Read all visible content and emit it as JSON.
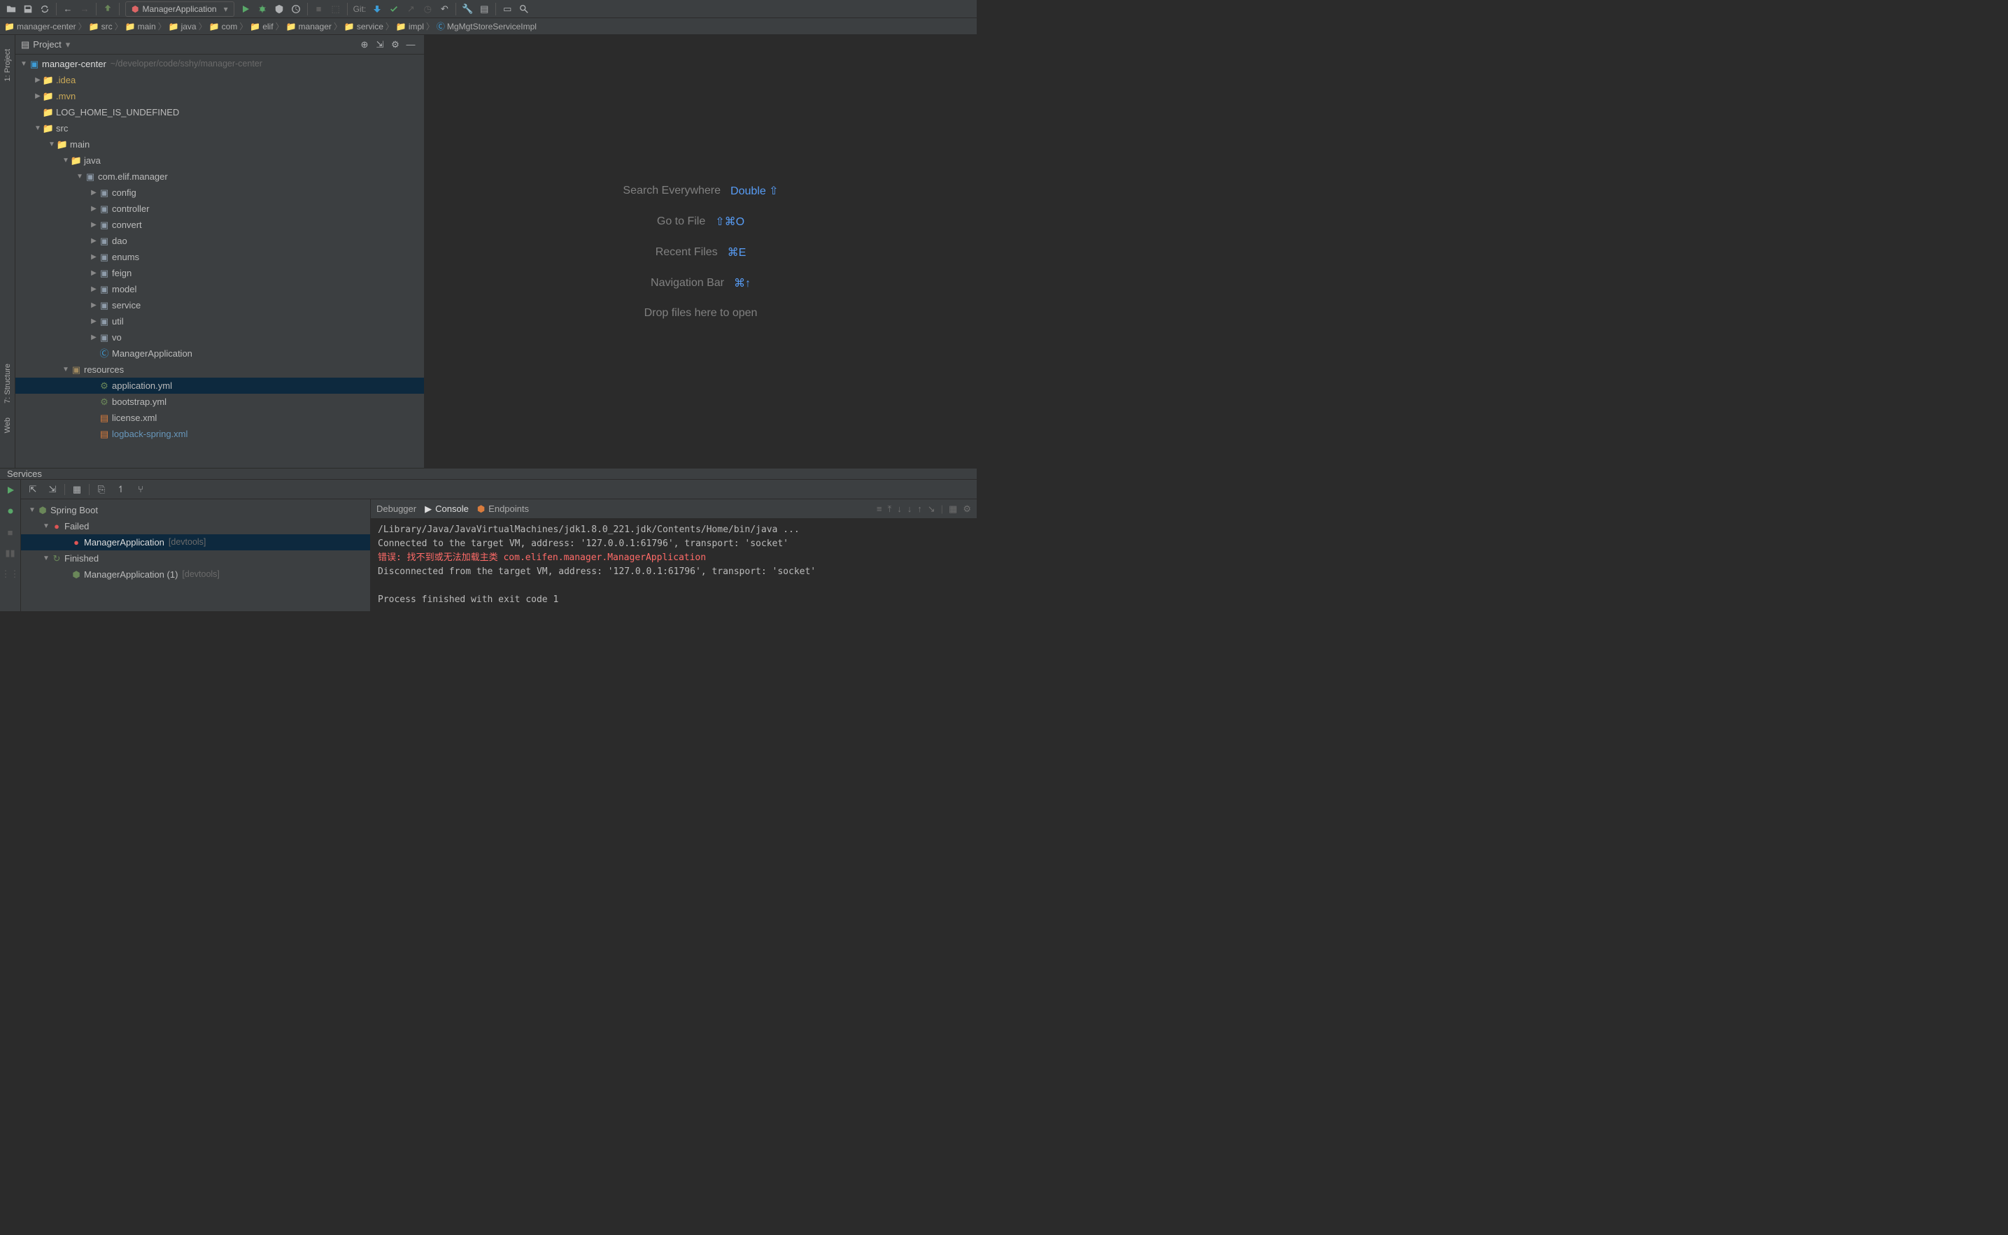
{
  "toolbar": {
    "runConfig": "ManagerApplication",
    "gitLabel": "Git:"
  },
  "breadcrumbs": [
    {
      "icon": "folder-blue",
      "label": "manager-center"
    },
    {
      "icon": "folder-blue",
      "label": "src"
    },
    {
      "icon": "folder-blue",
      "label": "main"
    },
    {
      "icon": "folder-blue",
      "label": "java"
    },
    {
      "icon": "folder",
      "label": "com"
    },
    {
      "icon": "folder",
      "label": "elif"
    },
    {
      "icon": "folder",
      "label": "manager"
    },
    {
      "icon": "folder",
      "label": "service"
    },
    {
      "icon": "folder",
      "label": "impl"
    },
    {
      "icon": "class",
      "label": "MgMgtStoreServiceImpl"
    }
  ],
  "projectPanel": {
    "title": "Project",
    "root": {
      "label": "manager-center",
      "hint": "~/developer/code/sshy/manager-center"
    },
    "tree": {
      "idea": ".idea",
      "mvn": ".mvn",
      "logHome": "LOG_HOME_IS_UNDEFINED",
      "src": "src",
      "main": "main",
      "java": "java",
      "pkg": "com.elif.manager",
      "config": "config",
      "controller": "controller",
      "convert": "convert",
      "dao": "dao",
      "enums": "enums",
      "feign": "feign",
      "model": "model",
      "service": "service",
      "util": "util",
      "vo": "vo",
      "app": "ManagerApplication",
      "resources": "resources",
      "appyml": "application.yml",
      "bootyml": "bootstrap.yml",
      "license": "license.xml",
      "logback": "logback-spring.xml"
    }
  },
  "editorHints": {
    "search": {
      "label": "Search Everywhere",
      "shortcut": "Double ⇧"
    },
    "gotoFile": {
      "label": "Go to File",
      "shortcut": "⇧⌘O"
    },
    "recent": {
      "label": "Recent Files",
      "shortcut": "⌘E"
    },
    "navBar": {
      "label": "Navigation Bar",
      "shortcut": "⌘↑"
    },
    "drop": {
      "label": "Drop files here to open"
    }
  },
  "services": {
    "title": "Services",
    "springBoot": "Spring Boot",
    "failed": "Failed",
    "app1": {
      "label": "ManagerApplication",
      "hint": "[devtools]"
    },
    "finished": "Finished",
    "app2": {
      "label": "ManagerApplication (1)",
      "hint": "[devtools]"
    }
  },
  "consoleTabs": {
    "debugger": "Debugger",
    "console": "Console",
    "endpoints": "Endpoints"
  },
  "console": {
    "line1": "/Library/Java/JavaVirtualMachines/jdk1.8.0_221.jdk/Contents/Home/bin/java ...",
    "line2": "Connected to the target VM, address: '127.0.0.1:61796', transport: 'socket'",
    "line3a": "错误: 找不到或无法加载主类 ",
    "line3b": "com.elifen.manager.ManagerApplication",
    "line4": "Disconnected from the target VM, address: '127.0.0.1:61796', transport: 'socket'",
    "line5": "",
    "line6": "Process finished with exit code 1"
  },
  "leftTabs": {
    "project": "1: Project",
    "structure": "7: Structure",
    "web": "Web"
  }
}
